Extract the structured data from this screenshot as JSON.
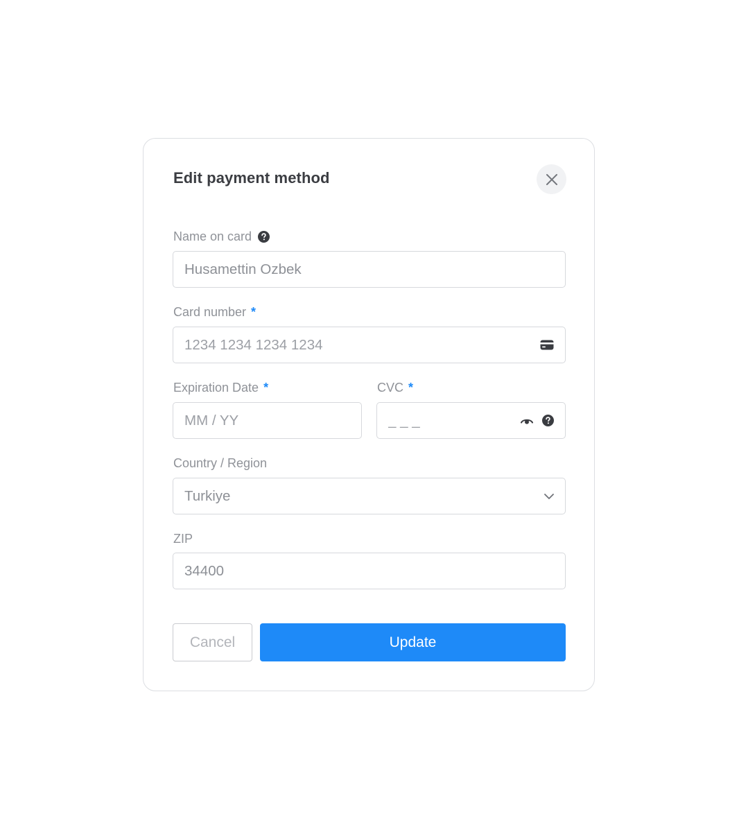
{
  "dialog": {
    "title": "Edit payment method",
    "close_icon": "close-icon"
  },
  "fields": {
    "name_on_card": {
      "label": "Name on card",
      "value": "Husamettin Ozbek",
      "help_icon": "question-circle-icon"
    },
    "card_number": {
      "label": "Card number",
      "required_marker": "*",
      "placeholder": "1234 1234 1234 1234",
      "icon": "credit-card-icon"
    },
    "expiration_date": {
      "label": "Expiration Date",
      "required_marker": "*",
      "placeholder": "MM / YY"
    },
    "cvc": {
      "label": "CVC",
      "required_marker": "*",
      "placeholder": "_ _ _",
      "icons": [
        "eye-icon",
        "question-circle-icon"
      ]
    },
    "country_region": {
      "label": "Country / Region",
      "value": "Turkiye",
      "icon": "chevron-down-icon"
    },
    "zip": {
      "label": "ZIP",
      "value": "34400"
    }
  },
  "actions": {
    "cancel_label": "Cancel",
    "update_label": "Update"
  },
  "colors": {
    "accent": "#1e8af8",
    "label": "#8f9298",
    "border": "#d6d8dc",
    "title": "#3b3d42"
  }
}
